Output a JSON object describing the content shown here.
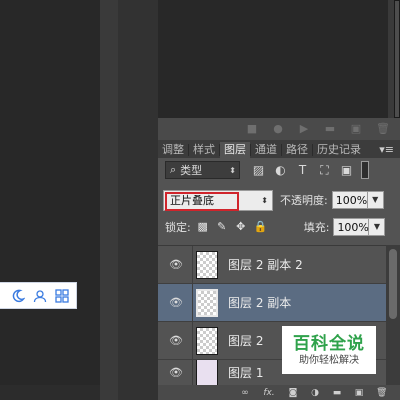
{
  "panel": {
    "tabs": [
      {
        "label": "调整",
        "active": false
      },
      {
        "label": "样式",
        "active": false
      },
      {
        "label": "图层",
        "active": true
      },
      {
        "label": "通道",
        "active": false
      },
      {
        "label": "路径",
        "active": false
      },
      {
        "label": "历史记录",
        "active": false
      }
    ],
    "menu_glyph": "▾≡",
    "filter": {
      "label": "类型",
      "icon": "search-icon"
    },
    "blend_mode": "正片叠底",
    "opacity_label": "不透明度:",
    "opacity_value": "100%",
    "lock_label": "锁定:",
    "fill_label": "填充:",
    "fill_value": "100%",
    "layers": [
      {
        "name": "图层 2 副本 2",
        "selected": false
      },
      {
        "name": "图层 2 副本",
        "selected": true
      },
      {
        "name": "图层 2",
        "selected": false
      },
      {
        "name": "图层 1",
        "selected": false
      }
    ],
    "bottom_icons": [
      "link-icon",
      "fx-icon",
      "mask-icon",
      "adjustment-icon",
      "group-icon",
      "new-layer-icon",
      "trash-icon"
    ],
    "bottom_fx": "fx."
  },
  "watermark": {
    "title": "百科全说",
    "subtitle": "助你轻松解决"
  },
  "colors": {
    "panel_bg": "#535353",
    "selected_row": "#5b6c82",
    "highlight_border": "#d0242b",
    "watermark_green": "#2fa24b"
  }
}
